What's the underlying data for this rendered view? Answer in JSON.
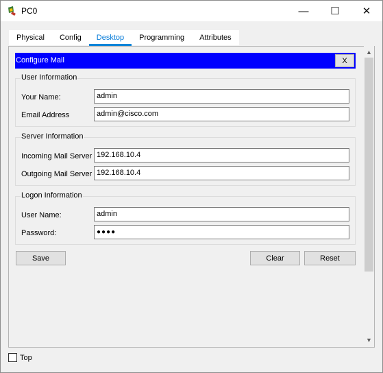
{
  "window": {
    "title": "PC0",
    "minimize_glyph": "—",
    "maximize_glyph": "☐",
    "close_glyph": "✕"
  },
  "tabs": [
    {
      "label": "Physical"
    },
    {
      "label": "Config"
    },
    {
      "label": "Desktop"
    },
    {
      "label": "Programming"
    },
    {
      "label": "Attributes"
    }
  ],
  "active_tab": "Desktop",
  "panel": {
    "title": "Configure Mail",
    "close_label": "X"
  },
  "user_info": {
    "title": "User Information",
    "name_label": "Your Name:",
    "name_value": "admin",
    "email_label": "Email Address",
    "email_value": "admin@cisco.com"
  },
  "server_info": {
    "title": "Server Information",
    "incoming_label": "Incoming Mail Server",
    "incoming_value": "192.168.10.4",
    "outgoing_label": "Outgoing Mail Server",
    "outgoing_value": "192.168.10.4"
  },
  "logon_info": {
    "title": "Logon Information",
    "username_label": "User Name:",
    "username_value": "admin",
    "password_label": "Password:",
    "password_value": "●●●●"
  },
  "buttons": {
    "save": "Save",
    "clear": "Clear",
    "reset": "Reset"
  },
  "footer": {
    "top_label": "Top",
    "top_checked": false
  },
  "scrollbar": {
    "up_glyph": "▲",
    "down_glyph": "▼"
  },
  "colors": {
    "header_bar": "#0000ff",
    "active_tab": "#0078d7",
    "tab_underline": "#0a84d8"
  },
  "icons": {
    "app": "packet-tracer-pc-icon"
  }
}
